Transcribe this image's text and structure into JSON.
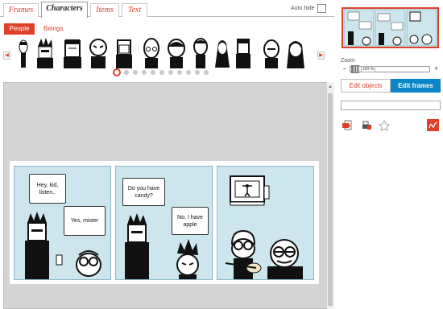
{
  "tabs": [
    {
      "label": "Frames"
    },
    {
      "label": "Characters"
    },
    {
      "label": "Items"
    },
    {
      "label": "Text"
    }
  ],
  "auto_hide": {
    "label": "Auto hide",
    "checked": false
  },
  "subtabs": {
    "people": "People",
    "beings": "Beings"
  },
  "characters": [
    "character-1",
    "character-2",
    "character-3",
    "character-4",
    "character-5",
    "character-6",
    "character-7",
    "character-8",
    "character-9",
    "character-10",
    "character-11",
    "character-12"
  ],
  "pagination": {
    "total": 12,
    "current": 1
  },
  "zoom": {
    "label": "Zoom",
    "value": "100 %"
  },
  "edit_modes": {
    "objects": "Edit objects",
    "frames": "Edit frames",
    "active": "frames"
  },
  "comic": {
    "panels": [
      {
        "bubbles": [
          "Hey, kid, listen..",
          "Yes, mister"
        ]
      },
      {
        "bubbles": [
          "Do you have candy?",
          "No, I have apple"
        ]
      },
      {
        "bubbles": []
      }
    ]
  },
  "thumbnail": {
    "bubbles": [
      "Hey, kid, listen..",
      "Yes, mister",
      "Do you have candy?",
      "No, I have apple"
    ]
  },
  "colors": {
    "accent": "#e0402a",
    "active_blue": "#0c86c6",
    "panel_bg": "#cde6ee",
    "workspace_bg": "#d4d4d4"
  },
  "toolbar_icons": [
    "exit-icon",
    "print-icon",
    "stamp-icon",
    "signature-icon"
  ]
}
